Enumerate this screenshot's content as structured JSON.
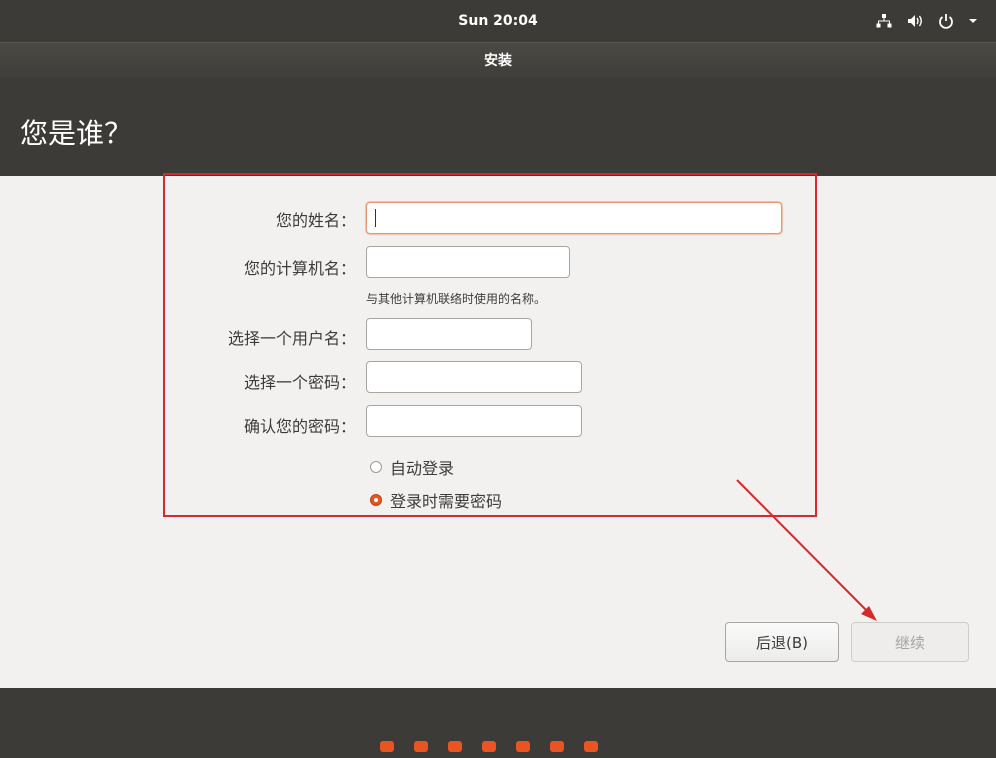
{
  "top_panel": {
    "clock": "Sun 20:04",
    "icons": [
      "network-icon",
      "volume-icon",
      "power-icon",
      "chevron-down-icon"
    ]
  },
  "window": {
    "title": "安装"
  },
  "page": {
    "heading": "您是谁？"
  },
  "form": {
    "name_label": "您的姓名：",
    "name_value": "",
    "computer_label": "您的计算机名：",
    "computer_value": "",
    "computer_hint": "与其他计算机联络时使用的名称。",
    "username_label": "选择一个用户名：",
    "username_value": "",
    "password_label": "选择一个密码：",
    "password_value": "",
    "confirm_label": "确认您的密码：",
    "confirm_value": "",
    "auto_login_label": "自动登录",
    "require_password_label": "登录时需要密码",
    "selected_option": "登录时需要密码"
  },
  "buttons": {
    "back_label": "后退(B)",
    "continue_label": "继续"
  },
  "progress": {
    "total_steps": 7
  },
  "colors": {
    "accent": "#e95420",
    "annotation": "#d42a2a",
    "panel": "#3c3b37"
  }
}
